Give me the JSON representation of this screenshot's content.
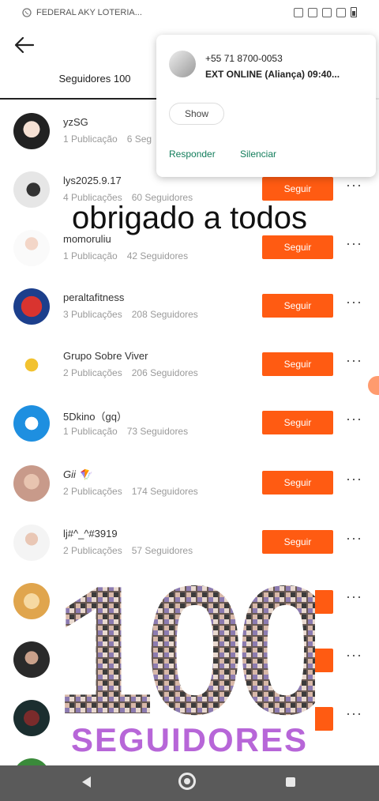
{
  "status_bar": {
    "notification_app": "FEDERAL AKY LOTERIA..."
  },
  "tabs": {
    "active": "Seguidores 100"
  },
  "followers": [
    {
      "name": "yzSG",
      "pubs": "1 Publicação",
      "followers": "6 Seg",
      "button": ""
    },
    {
      "name": "lys2025.9.17",
      "pubs": "4 Publicações",
      "followers": "60 Seguidores",
      "button": "Seguir"
    },
    {
      "name": "momoruliu",
      "pubs": "1 Publicação",
      "followers": "42 Seguidores",
      "button": "Seguir"
    },
    {
      "name": "peraltafitness",
      "pubs": "3 Publicações",
      "followers": "208 Seguidores",
      "button": "Seguir"
    },
    {
      "name": "Grupo Sobre Viver",
      "pubs": "2 Publicações",
      "followers": "206 Seguidores",
      "button": "Seguir"
    },
    {
      "name": "5Dkino（gq）",
      "pubs": "1 Publicação",
      "followers": "73 Seguidores",
      "button": "Seguir"
    },
    {
      "name": "Gii 🪁",
      "pubs": "2 Publicações",
      "followers": "174 Seguidores",
      "button": "Seguir"
    },
    {
      "name": "lj#^_^#3919",
      "pubs": "2 Publicações",
      "followers": "57 Seguidores",
      "button": "Seguir"
    }
  ],
  "notification": {
    "phone": "+55 71 8700-0053",
    "message": "EXT ONLINE (Aliança) 09:40...",
    "show_button": "Show",
    "action_reply": "Responder",
    "action_silence": "Silenciar"
  },
  "overlay": {
    "caption": "obrigado a todos",
    "big_number": "100",
    "big_label": "SEGUIDORES"
  },
  "colors": {
    "follow_button": "#ff5b12",
    "notif_action": "#127d5b",
    "seguidores_text": "#b766d8"
  }
}
